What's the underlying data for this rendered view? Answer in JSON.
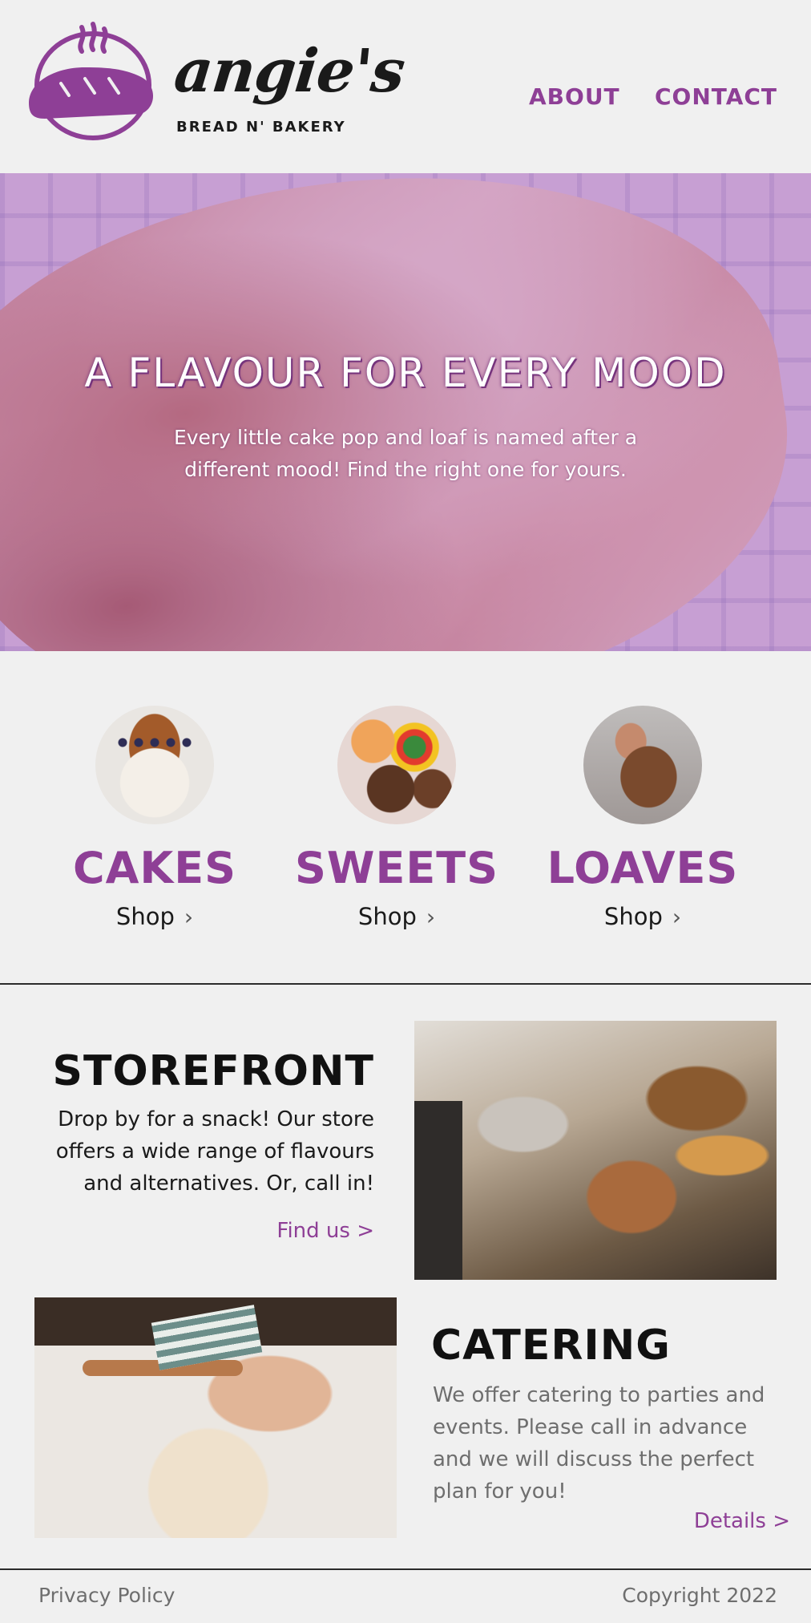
{
  "brand": {
    "logo_icon": "bread-icon",
    "name": "angie's",
    "tagline": "BREAD N' BAKERY",
    "accent_color": "#8e3f96"
  },
  "nav": {
    "about": "ABOUT",
    "contact": "CONTACT"
  },
  "hero": {
    "title": "A FLAVOUR FOR EVERY MOOD",
    "subtitle": "Every little cake pop and loaf is named after a different mood! Find the right one for yours."
  },
  "categories": [
    {
      "name": "CAKES",
      "shop": "Shop",
      "icon": "chevron-right-icon"
    },
    {
      "name": "SWEETS",
      "shop": "Shop",
      "icon": "chevron-right-icon"
    },
    {
      "name": "LOAVES",
      "shop": "Shop",
      "icon": "chevron-right-icon"
    }
  ],
  "storefront": {
    "title": "STOREFRONT",
    "text": "Drop by for a snack! Our store offers a wide range of flavours and alternatives. Or, call in!",
    "link": "Find us >"
  },
  "catering": {
    "title": "CATERING",
    "text": "We offer catering to parties and events. Please call in advance and we will discuss the perfect plan for you!",
    "link": "Details >"
  },
  "footer": {
    "privacy": "Privacy Policy",
    "copyright": "Copyright 2022"
  }
}
